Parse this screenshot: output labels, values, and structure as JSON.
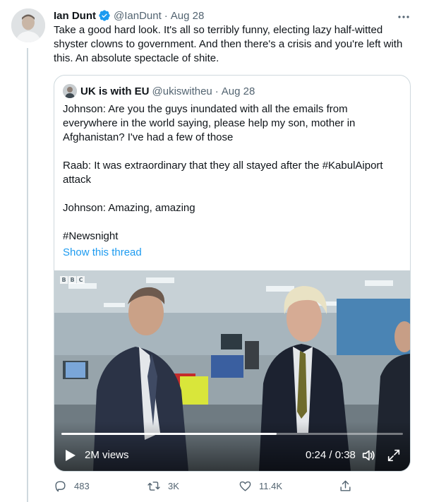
{
  "tweet": {
    "author_name": "Ian Dunt",
    "author_handle": "@IanDunt",
    "separator": "·",
    "timestamp": "Aug 28",
    "text": "Take a good hard look. It's all so terribly funny, electing lazy half-witted shyster clowns to government. And then there's a crisis and you're left with this. An absolute spectacle of shite.",
    "icons": {
      "more": "more-horizontal-icon",
      "verified": "verified-badge-icon"
    }
  },
  "quote": {
    "author_name": "UK is with EU",
    "author_handle": "@ukiswitheu",
    "separator": "·",
    "timestamp": "Aug 28",
    "paragraphs": [
      "Johnson: Are you the guys inundated with all the emails from everywhere in the world saying, please help my son, mother in Afghanistan? I've had a few of those",
      "Raab: It was extraordinary that they all stayed after the #KabulAiport attack",
      "Johnson: Amazing, amazing",
      "#Newsnight"
    ],
    "show_thread": "Show this thread",
    "video": {
      "channel_logo": [
        "B",
        "B",
        "C"
      ],
      "views": "2M views",
      "time_display": "0:24 / 0:38",
      "progress_fraction": 0.63
    }
  },
  "actions": {
    "reply_count": "483",
    "retweet_count": "3K",
    "like_count": "11.4K"
  },
  "colors": {
    "accent": "#1d9bf0",
    "text": "#0f1419",
    "muted": "#536471",
    "border": "#cfd9de"
  }
}
